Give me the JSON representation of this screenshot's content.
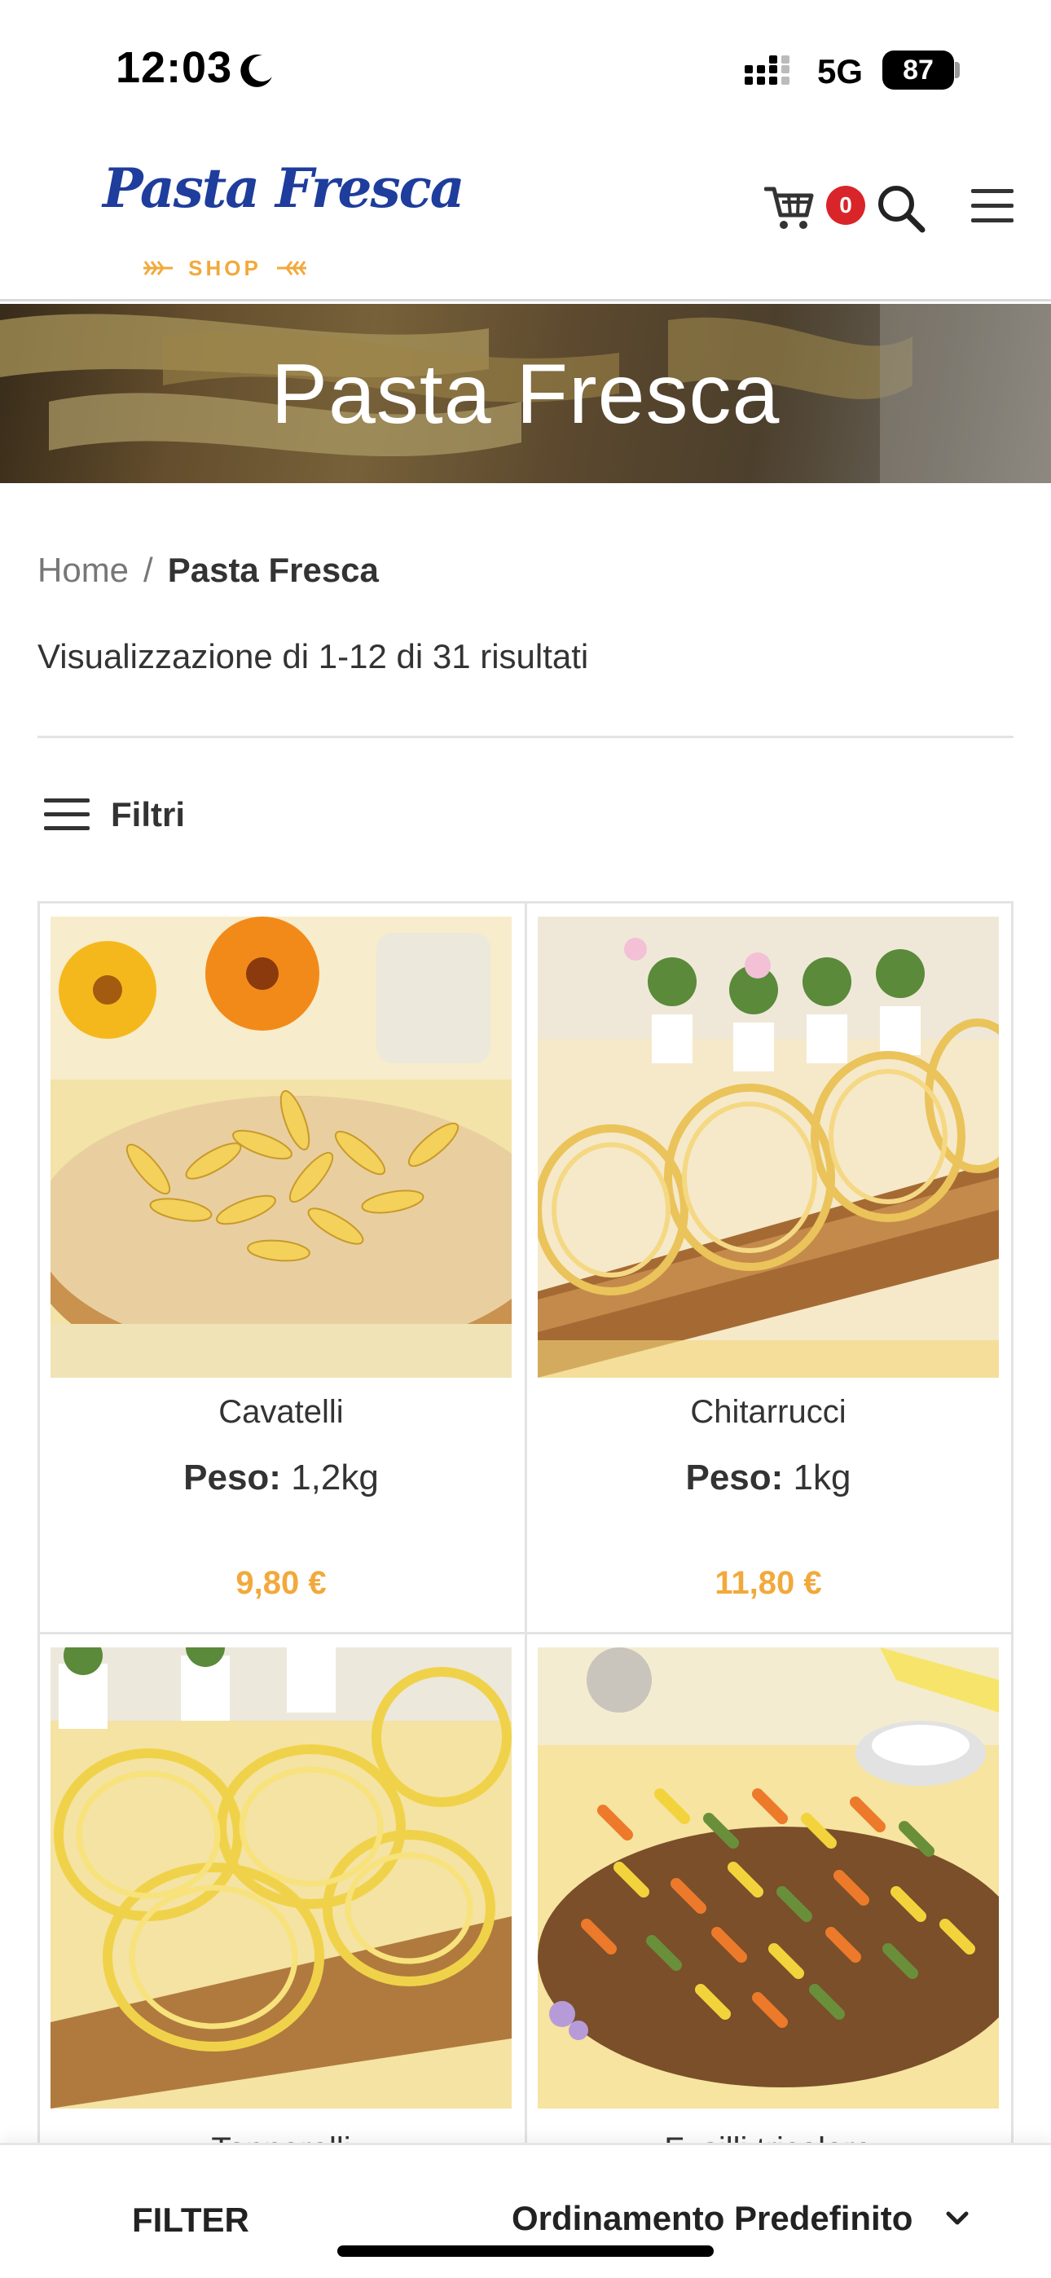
{
  "status_bar": {
    "time": "12:03",
    "network": "5G",
    "battery": "87"
  },
  "header": {
    "logo_text": "Pasta Fresca",
    "logo_sub": "SHOP",
    "cart_count": "0"
  },
  "hero": {
    "title": "Pasta Fresca"
  },
  "breadcrumb": {
    "home": "Home",
    "separator": "/",
    "current": "Pasta Fresca"
  },
  "results": {
    "text": "Visualizzazione di 1-12 di 31 risultati"
  },
  "filters": {
    "label": "Filtri"
  },
  "products": [
    {
      "name": "Cavatelli",
      "weight_label": "Peso:",
      "weight": "1,2kg",
      "price": "9,80 €"
    },
    {
      "name": "Chitarrucci",
      "weight_label": "Peso:",
      "weight": "1kg",
      "price": "11,80 €"
    },
    {
      "name": "Tonnarelli"
    },
    {
      "name": "Fusilli tricolore"
    }
  ],
  "bottom_bar": {
    "filter": "FILTER",
    "sort": "Ordinamento Predefinito"
  },
  "colors": {
    "brand_blue": "#1e3d9c",
    "price_orange": "#f2a93b",
    "badge_red": "#d9252a"
  }
}
